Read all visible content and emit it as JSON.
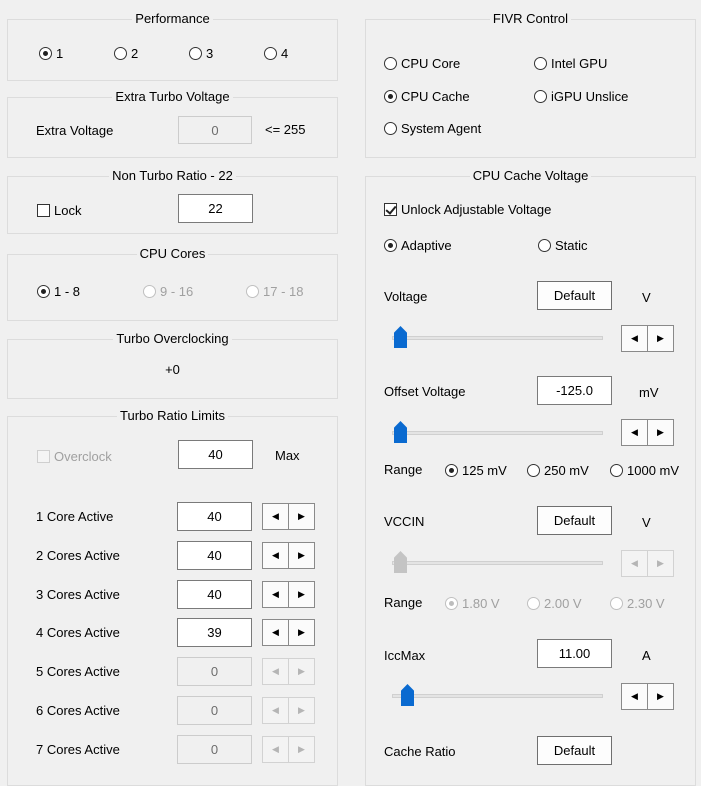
{
  "performance": {
    "title": "Performance",
    "options": [
      "1",
      "2",
      "3",
      "4"
    ],
    "selected": "1"
  },
  "extra_turbo": {
    "title": "Extra Turbo Voltage",
    "label": "Extra Voltage",
    "value": "0",
    "limit": "<= 255"
  },
  "non_turbo": {
    "title": "Non Turbo Ratio - 22",
    "lock_label": "Lock",
    "lock_checked": false,
    "value": "22"
  },
  "cpu_cores": {
    "title": "CPU Cores",
    "options": [
      "1 - 8",
      "9 - 16",
      "17 - 18"
    ],
    "selected": "1 - 8"
  },
  "turbo_oc": {
    "title": "Turbo Overclocking",
    "value": "+0"
  },
  "turbo_ratio": {
    "title": "Turbo Ratio Limits",
    "overclock_label": "Overclock",
    "overclock_value": "40",
    "max_label": "Max",
    "rows": [
      {
        "label": "1 Core Active",
        "value": "40",
        "enabled": true
      },
      {
        "label": "2 Cores Active",
        "value": "40",
        "enabled": true
      },
      {
        "label": "3 Cores Active",
        "value": "40",
        "enabled": true
      },
      {
        "label": "4 Cores Active",
        "value": "39",
        "enabled": true
      },
      {
        "label": "5 Cores Active",
        "value": "0",
        "enabled": false
      },
      {
        "label": "6 Cores Active",
        "value": "0",
        "enabled": false
      },
      {
        "label": "7 Cores Active",
        "value": "0",
        "enabled": false
      }
    ]
  },
  "fivr": {
    "title": "FIVR Control",
    "options": [
      "CPU Core",
      "Intel GPU",
      "CPU Cache",
      "iGPU Unslice",
      "System Agent"
    ],
    "selected": "CPU Cache"
  },
  "cache_voltage": {
    "title": "CPU Cache Voltage",
    "unlock_label": "Unlock Adjustable Voltage",
    "unlock_checked": true,
    "mode_options": [
      "Adaptive",
      "Static"
    ],
    "mode_selected": "Adaptive",
    "voltage_label": "Voltage",
    "voltage_value": "Default",
    "voltage_unit": "V",
    "voltage_slider_level": 0.0,
    "offset_label": "Offset Voltage",
    "offset_value": "-125.0",
    "offset_unit": "mV",
    "offset_slider_level": 0.0,
    "range_label": "Range",
    "range_options": [
      "125 mV",
      "250 mV",
      "1000 mV"
    ],
    "range_selected": "125 mV",
    "vccin_label": "VCCIN",
    "vccin_value": "Default",
    "vccin_unit": "V",
    "vccin_slider_level": 0.0,
    "vccin_range_label": "Range",
    "vccin_range_options": [
      "1.80 V",
      "2.00 V",
      "2.30 V"
    ],
    "vccin_range_selected": "1.80 V",
    "iccmax_label": "IccMax",
    "iccmax_value": "11.00",
    "iccmax_unit": "A",
    "iccmax_slider_level": 0.04,
    "cache_ratio_label": "Cache Ratio",
    "cache_ratio_value": "Default"
  },
  "icons": {
    "spin_left": "left-arrow-icon",
    "spin_right": "right-arrow-icon"
  }
}
